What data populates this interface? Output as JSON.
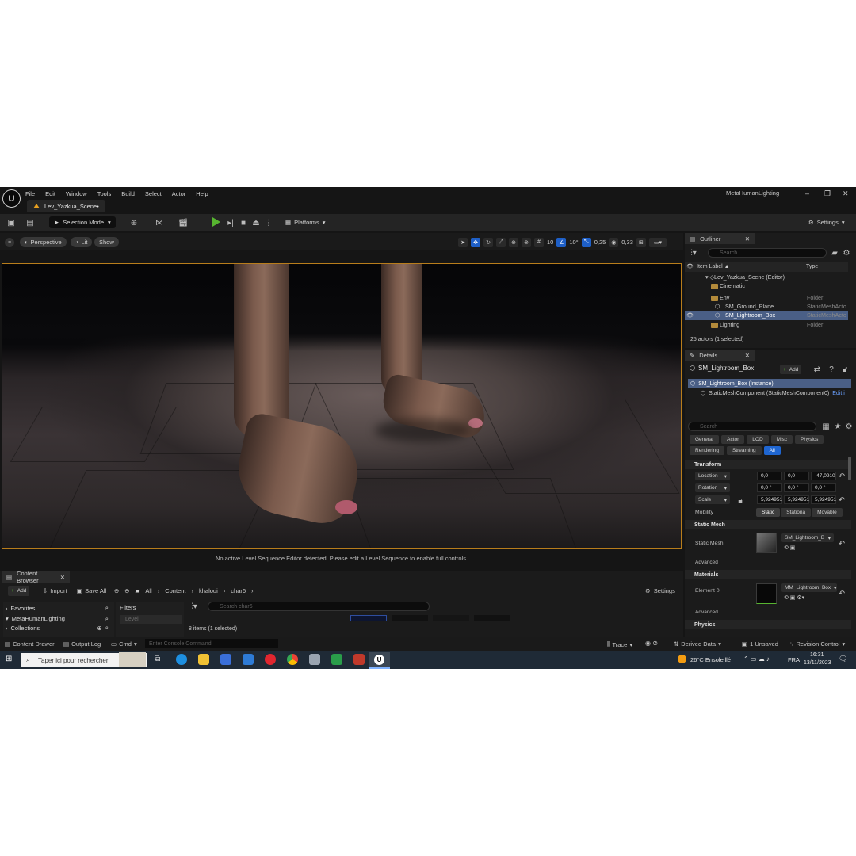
{
  "titlebar": {
    "menu": [
      "File",
      "Edit",
      "Window",
      "Tools",
      "Build",
      "Select",
      "Actor",
      "Help"
    ],
    "level_tab": "Lev_Yazkua_Scene•",
    "project": "MetaHumanLighting"
  },
  "toolbar": {
    "selection_mode": "Selection Mode",
    "platforms": "Platforms",
    "settings": "Settings"
  },
  "viewport": {
    "perspective": "Perspective",
    "lit": "Lit",
    "show": "Show",
    "grid_snap": "10",
    "rotation_snap": "10°",
    "scale_snap": "0,25",
    "camera_speed": "0,33",
    "notice": "No active Level Sequence Editor detected. Please edit a Level Sequence to enable full controls."
  },
  "outliner": {
    "title": "Outliner",
    "search_placeholder": "Search...",
    "col_label": "Item Label ▲",
    "col_type": "Type",
    "rows": [
      {
        "label": "Lev_Yazkua_Scene (Editor)",
        "type": ""
      },
      {
        "label": "Cinematic",
        "type": ""
      },
      {
        "label": "Env",
        "type": "Folder"
      },
      {
        "label": "SM_Ground_Plane",
        "type": "StaticMeshActo"
      },
      {
        "label": "SM_Lightroom_Box",
        "type": "StaticMeshActo"
      },
      {
        "label": "Lighting",
        "type": "Folder"
      }
    ],
    "footer": "25 actors (1 selected)"
  },
  "details": {
    "title": "Details",
    "actor_name": "SM_Lightroom_Box",
    "add": "Add",
    "instance": "SM_Lightroom_Box (Instance)",
    "component": "StaticMeshComponent (StaticMeshComponent0)",
    "edit": "Edit i",
    "search_placeholder": "Search",
    "filters_row1": [
      "General",
      "Actor",
      "LOD",
      "Misc",
      "Physics"
    ],
    "filters_row2": [
      "Rendering",
      "Streaming",
      "All"
    ],
    "transform": {
      "section": "Transform",
      "location_label": "Location",
      "location": [
        "0,0",
        "0,0",
        "-47,0910"
      ],
      "rotation_label": "Rotation",
      "rotation": [
        "0,0 °",
        "0,0 °",
        "0,0 °"
      ],
      "scale_label": "Scale",
      "scale": [
        "5,924951",
        "5,924951",
        "5,924951"
      ],
      "mobility_label": "Mobility",
      "mobility": [
        "Static",
        "Stationa",
        "Movable"
      ]
    },
    "static_mesh": {
      "section": "Static Mesh",
      "label": "Static Mesh",
      "value": "SM_Lightroom_B",
      "advanced": "Advanced"
    },
    "materials": {
      "section": "Materials",
      "label": "Element 0",
      "value": "MM_Lightroom_Box",
      "advanced": "Advanced"
    },
    "physics": {
      "section": "Physics"
    }
  },
  "content_browser": {
    "tab": "Content Browser",
    "add": "Add",
    "import": "Import",
    "save_all": "Save All",
    "path": [
      "All",
      "Content",
      "khaloui",
      "char6"
    ],
    "settings": "Settings",
    "favorites": "Favorites",
    "project_folder": "MetaHumanLighting",
    "collections": "Collections",
    "filters": "Filters",
    "filter_item": "Level",
    "search_placeholder": "Search char6",
    "items_count": "8 items (1 selected)"
  },
  "statusbar": {
    "content_drawer": "Content Drawer",
    "output_log": "Output Log",
    "cmd": "Cmd",
    "console_placeholder": "Enter Console Command",
    "trace": "Trace",
    "derived_data": "Derived Data",
    "unsaved": "1 Unsaved",
    "revision_control": "Revision Control"
  },
  "taskbar": {
    "search_placeholder": "Taper ici pour rechercher",
    "weather": "26°C  Ensoleillé",
    "lang": "FRA",
    "time": "16:31",
    "date": "13/11/2023"
  },
  "colors": {
    "accent_blue": "#1f66d1",
    "play_green": "#57b530",
    "selection_row": "#4a5f86",
    "viewport_border": "#b87d1b"
  }
}
